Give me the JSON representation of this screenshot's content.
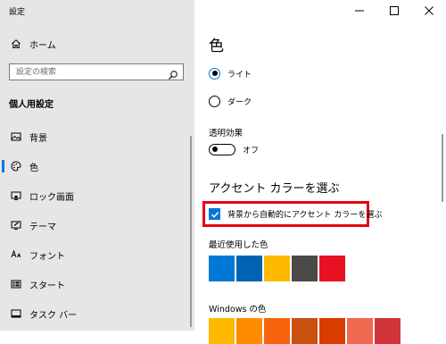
{
  "window": {
    "title": "設定",
    "controls": [
      "minimize",
      "maximize",
      "close"
    ]
  },
  "nav": {
    "home_label": "ホーム",
    "search_placeholder": "設定の検索",
    "group_heading": "個人用設定",
    "items": [
      {
        "label": "背景",
        "icon": "picture-icon",
        "selected": false
      },
      {
        "label": "色",
        "icon": "palette-icon",
        "selected": true
      },
      {
        "label": "ロック画面",
        "icon": "lock-screen-icon",
        "selected": false
      },
      {
        "label": "テーマ",
        "icon": "brush-icon",
        "selected": false
      },
      {
        "label": "フォント",
        "icon": "font-icon",
        "selected": false
      },
      {
        "label": "スタート",
        "icon": "start-icon",
        "selected": false
      },
      {
        "label": "タスク バー",
        "icon": "taskbar-icon",
        "selected": false
      }
    ]
  },
  "content": {
    "title": "色",
    "mode_options": [
      {
        "label": "ライト",
        "selected": true
      },
      {
        "label": "ダーク",
        "selected": false
      }
    ],
    "transparency": {
      "label": "透明効果",
      "state_label": "オフ",
      "on": false
    },
    "accent_heading": "アクセント カラーを選ぶ",
    "auto_accent": {
      "label": "背景から自動的にアクセント カラーを選ぶ",
      "checked": true
    },
    "recent_colors": {
      "label": "最近使用した色",
      "colors": [
        "#0078d7",
        "#0063b1",
        "#ffb900",
        "#4c4a48",
        "#e81123"
      ]
    },
    "windows_colors": {
      "label": "Windows の色",
      "colors": [
        "#ffb900",
        "#ff8c00",
        "#f7630c",
        "#ca5010",
        "#da3b01",
        "#ef6950",
        "#d13438"
      ]
    },
    "accent_color": "#0078d7",
    "highlight_color": "#e60012"
  }
}
